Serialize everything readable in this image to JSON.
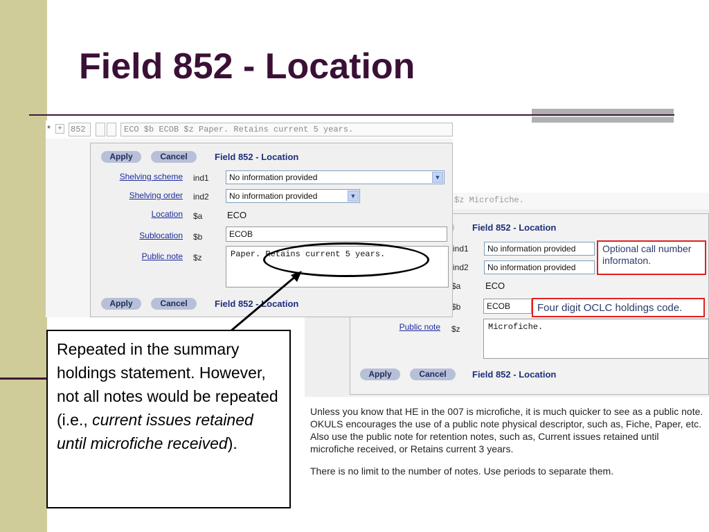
{
  "slide": {
    "title": "Field 852 - Location"
  },
  "record_row": {
    "star": "*",
    "plus": "+",
    "tag": "852",
    "data": "ECO $b ECOB $z Paper. Retains current 5 years."
  },
  "back_row": {
    "data": "$z Microfiche."
  },
  "form1": {
    "apply_label": "Apply",
    "cancel_label": "Cancel",
    "title": "Field 852 - Location",
    "rows": {
      "shelving_scheme": {
        "label": "Shelving scheme",
        "code": "ind1",
        "value": "No information provided"
      },
      "shelving_order": {
        "label": "Shelving order",
        "code": "ind2",
        "value": "No information provided"
      },
      "location": {
        "label": "Location",
        "code": "$a",
        "value": "ECO"
      },
      "sublocation": {
        "label": "Sublocation",
        "code": "$b",
        "value": "ECOB"
      },
      "public_note": {
        "label": "Public note",
        "code": "$z",
        "value": "Paper. Retains current 5 years."
      }
    }
  },
  "form2": {
    "apply_label": "Apply",
    "cancel_label": "Cancel",
    "title": "Field 852 - Location",
    "rows": {
      "ind1": {
        "code": "ind1",
        "value": "No information provided"
      },
      "ind2": {
        "code": "ind2",
        "value": "No information provided"
      },
      "location": {
        "code": "$a",
        "value": "ECO"
      },
      "sublocation": {
        "code": "$b",
        "value": "ECOB"
      },
      "public_note": {
        "label": "Public note",
        "code": "$z",
        "value": "Microfiche."
      }
    }
  },
  "annotations": {
    "optional_call": "Optional call number informaton.",
    "oclc_code": "Four digit OCLC holdings code."
  },
  "explanation": {
    "para1": "Unless you know that HE in the 007 is microfiche, it is much quicker to see as a public note.  OKULS encourages the use of a public note physical descriptor, such as, Fiche, Paper, etc.  Also use the public note for retention notes, such as, Current issues retained until microfiche received, or Retains current 3 years.",
    "para2": "There is no limit to the number of notes.  Use periods to separate them."
  },
  "callout": {
    "text_plain": "Repeated in the summary holdings statement. However, not all notes would be repeated (i.e., ",
    "text_italic": "current issues retained until microfiche received",
    "text_end": ")."
  },
  "colors": {
    "title": "#3b1036",
    "sidebar": "#cfcc9a",
    "link": "#1c2a9c",
    "form_title": "#1e2f7a",
    "annotation_border": "#e02020"
  },
  "icons": {
    "dropdown": "chevron-down-icon"
  }
}
